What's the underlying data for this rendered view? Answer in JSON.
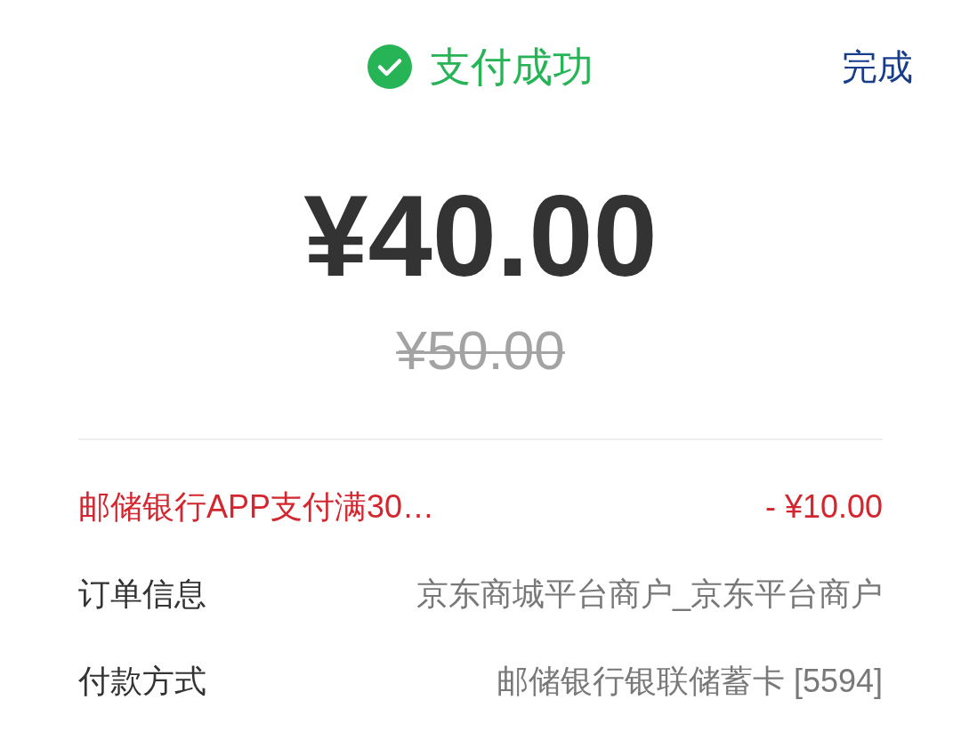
{
  "header": {
    "status": {
      "kind": "success",
      "title": "支付成功"
    },
    "done_button": "完成"
  },
  "amount": {
    "paid": "¥40.00",
    "original": "¥50.00"
  },
  "details": [
    {
      "kind": "discount",
      "label": "邮储银行APP支付满30…",
      "value": "- ¥10.00"
    },
    {
      "kind": "info",
      "label": "订单信息",
      "value": "京东商城平台商户_京东平台商户"
    },
    {
      "kind": "info",
      "label": "付款方式",
      "value": "邮储银行银联储蓄卡 [5594]"
    }
  ]
}
